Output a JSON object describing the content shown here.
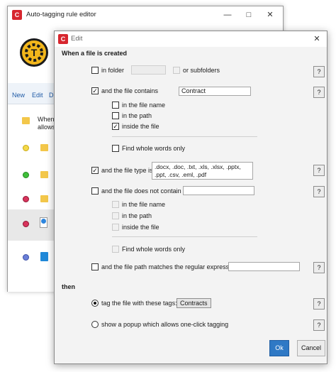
{
  "background_window": {
    "title": "Auto-tagging rule editor",
    "app_icon_letter": "C",
    "menu": [
      "New",
      "Edit",
      "D"
    ],
    "rows": [
      {
        "text1": "When",
        "text2": "allows"
      }
    ]
  },
  "dialog": {
    "title": "Edit",
    "app_icon_letter": "C",
    "close_glyph": "✕",
    "section_when": "When a file is created",
    "in_folder_label": "in folder",
    "or_subfolders_label": "or subfolders",
    "file_contains_label": "and the file contains",
    "file_contains_value": "Contract",
    "in_file_name_label": "in the file name",
    "in_path_label": "in the path",
    "inside_file_label": "inside the file",
    "whole_words_label": "Find whole words only",
    "file_type_label": "and the file type is",
    "file_type_value": ".docx, .doc, .txt, .xls, .xlsx, .pptx, .ppt, .csv, .eml, .pdf",
    "not_contain_label": "and the file does not contain",
    "not_in_file_name_label": "in the file name",
    "not_in_path_label": "in the path",
    "not_inside_file_label": "inside the file",
    "not_whole_words_label": "Find whole words only",
    "regex_label": "and the file path matches the regular expression",
    "section_then": "then",
    "tag_label": "tag the file with these tags:",
    "tag_value": "Contracts",
    "popup_label": "show a popup which allows one-click tagging",
    "help_label": "?",
    "ok_label": "Ok",
    "cancel_label": "Cancel",
    "checks": {
      "in_folder": false,
      "or_subfolders": false,
      "file_contains": true,
      "in_file_name": false,
      "in_path": false,
      "inside_file": true,
      "whole_words": false,
      "file_type": true,
      "not_contain": false,
      "regex": false
    },
    "selected_action": "tag",
    "check_glyph": "✓"
  },
  "colors": {
    "accent": "#2f79c5",
    "app_icon": "#d7262e"
  }
}
